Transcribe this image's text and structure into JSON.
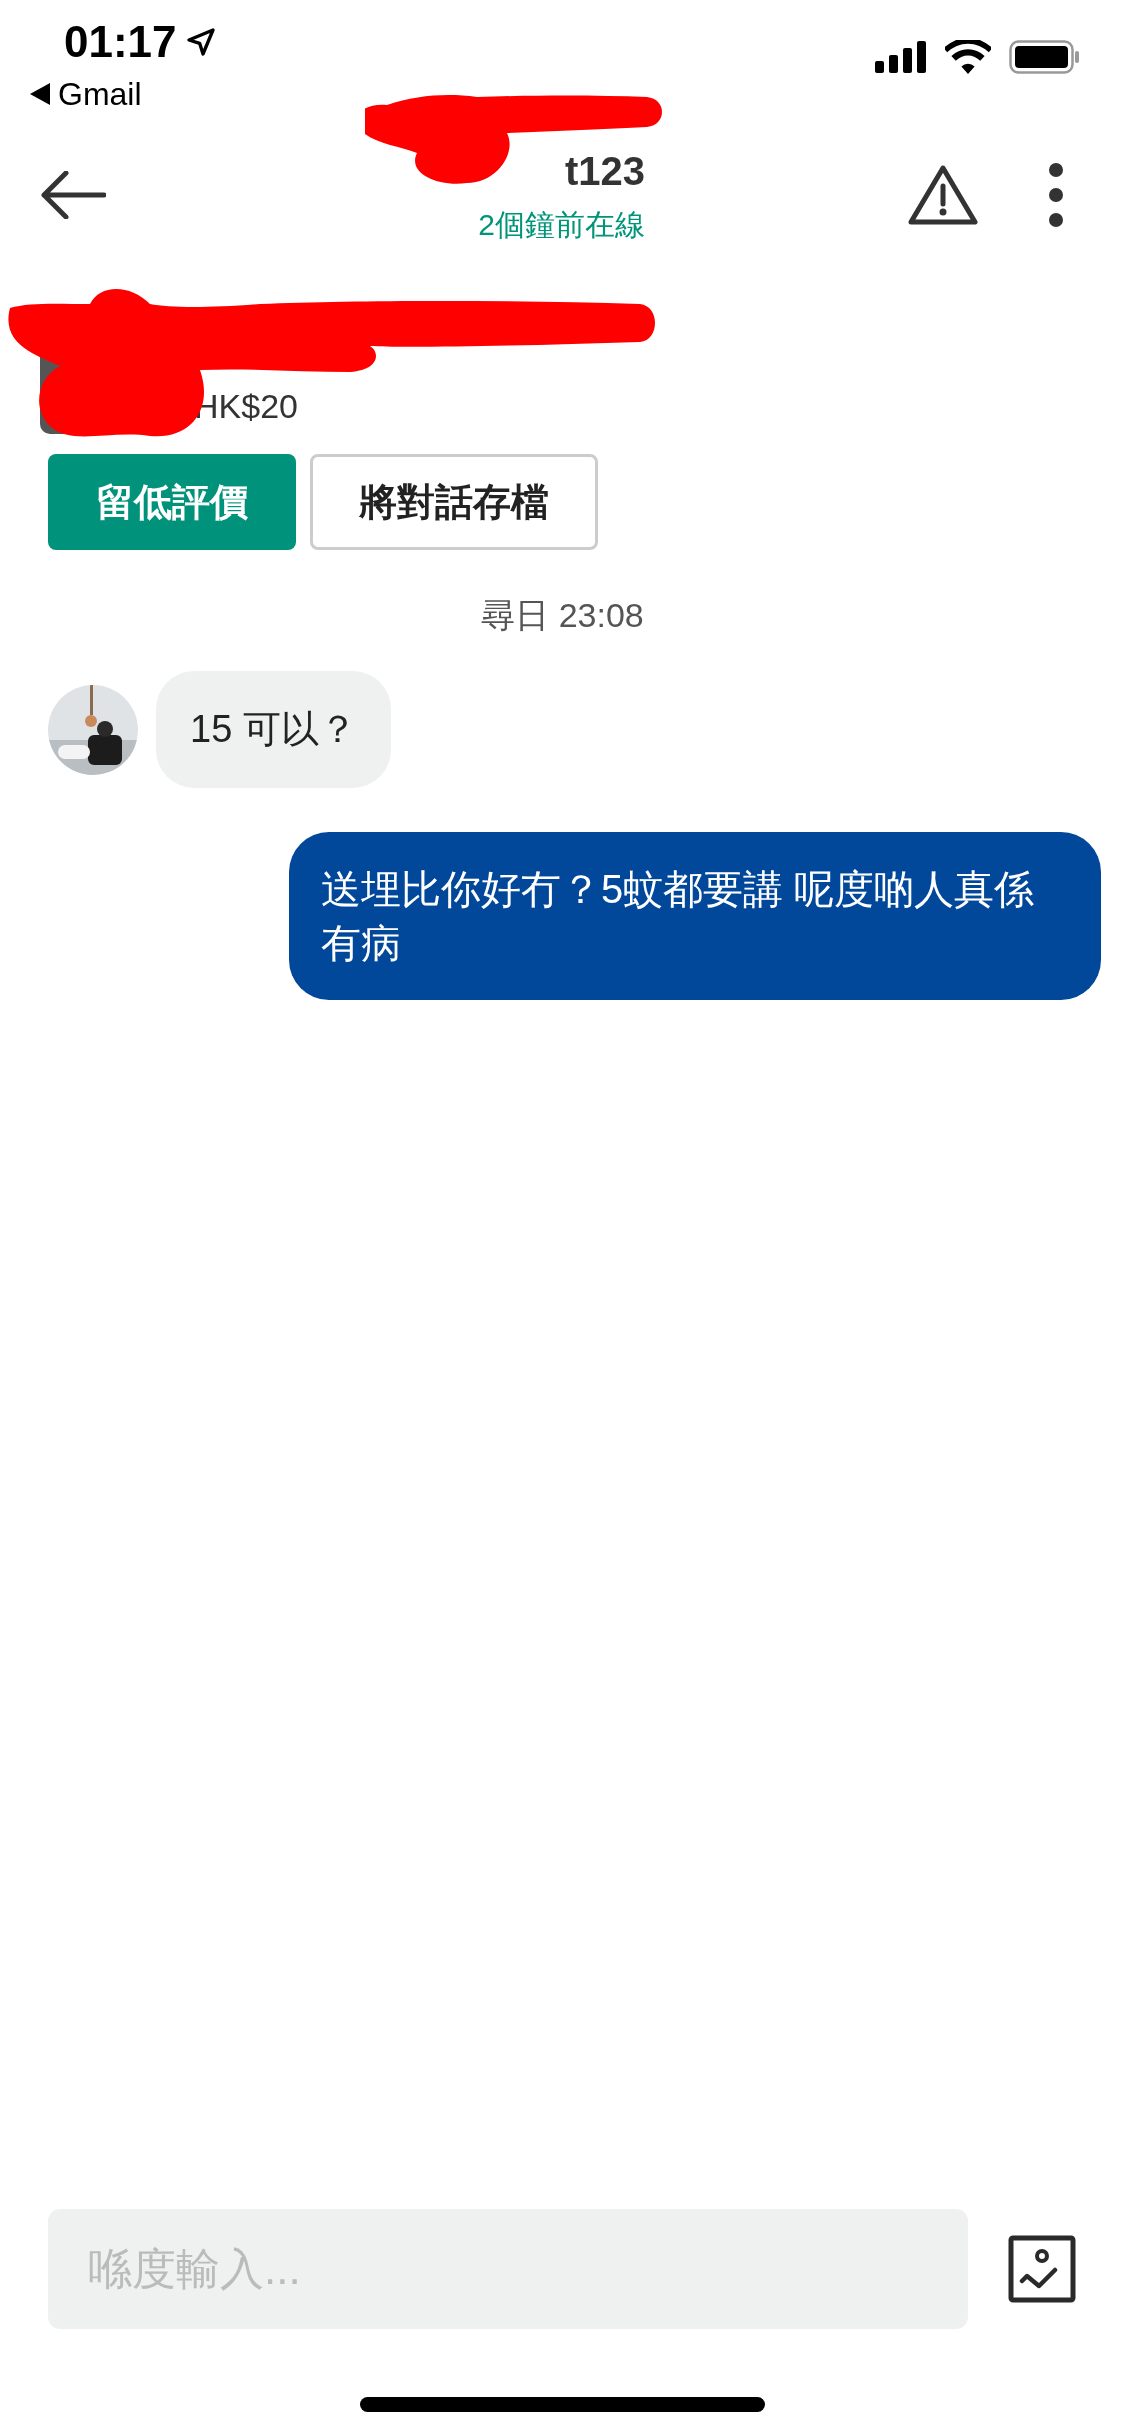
{
  "status_bar": {
    "time": "01:17",
    "back_app": "Gmail"
  },
  "header": {
    "name": "t123",
    "presence": "2個鐘前在線"
  },
  "listing": {
    "price": "HK$20"
  },
  "actions": [
    {
      "label": "留低評價",
      "kind": "primary"
    },
    {
      "label": "將對話存檔",
      "kind": "outline"
    }
  ],
  "timestamp": "尋日 23:08",
  "messages": [
    {
      "kind": "received",
      "text": "15 可以？"
    },
    {
      "kind": "sent",
      "text": "送埋比你好冇？5蚊都要講 呢度啲人真係有病"
    }
  ],
  "composer": {
    "placeholder": "喺度輸入..."
  }
}
